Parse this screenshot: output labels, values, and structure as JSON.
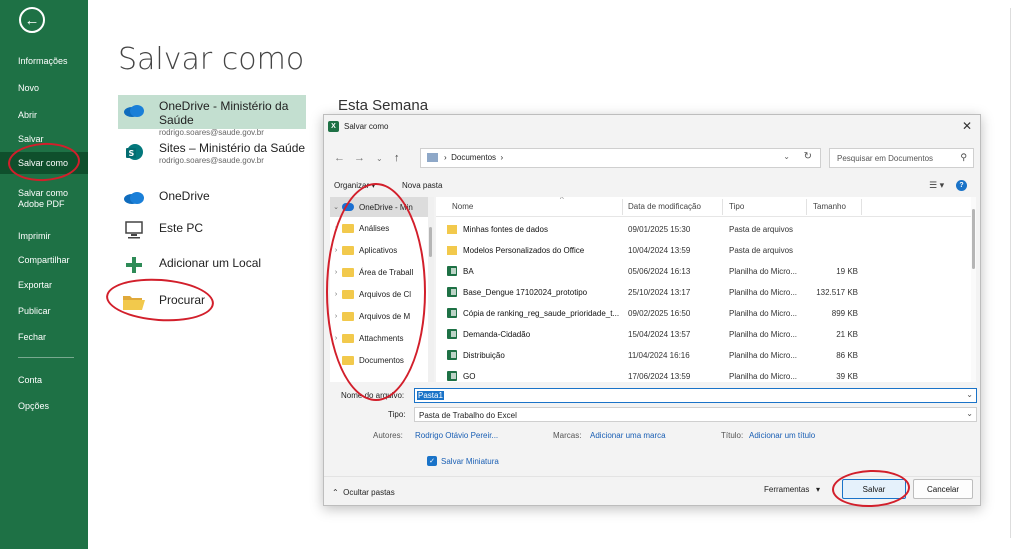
{
  "sidebar": {
    "items": [
      {
        "label": "Informações"
      },
      {
        "label": "Novo"
      },
      {
        "label": "Abrir"
      },
      {
        "label": "Salvar"
      },
      {
        "label": "Salvar como"
      },
      {
        "label": "Salvar como Adobe PDF"
      },
      {
        "label": "Imprimir"
      },
      {
        "label": "Compartilhar"
      },
      {
        "label": "Exportar"
      },
      {
        "label": "Publicar"
      },
      {
        "label": "Fechar"
      },
      {
        "label": "Conta"
      },
      {
        "label": "Opções"
      }
    ],
    "accent": "#1e7145"
  },
  "main": {
    "title": "Salvar como",
    "locations": [
      {
        "name": "OneDrive - Ministério da Saúde",
        "sub": "rodrigo.soares@saude.gov.br",
        "icon": "onedrive-icon"
      },
      {
        "name": "Sites – Ministério da Saúde",
        "sub": "rodrigo.soares@saude.gov.br",
        "icon": "sharepoint-icon"
      },
      {
        "name": "OneDrive",
        "sub": "",
        "icon": "onedrive-icon"
      },
      {
        "name": "Este PC",
        "sub": "",
        "icon": "pc-icon"
      },
      {
        "name": "Adicionar um Local",
        "sub": "",
        "icon": "plus-icon"
      },
      {
        "name": "Procurar",
        "sub": "",
        "icon": "folder-open-icon"
      }
    ],
    "section_label": "Esta Semana"
  },
  "dialog": {
    "title": "Salvar como",
    "address": "Documentos",
    "search_placeholder": "Pesquisar em Documentos",
    "organize": "Organizar",
    "new_folder": "Nova pasta",
    "tree": [
      {
        "label": "OneDrive - Min"
      },
      {
        "label": "Análises"
      },
      {
        "label": "Aplicativos"
      },
      {
        "label": "Área de Traball"
      },
      {
        "label": "Arquivos de Cl"
      },
      {
        "label": "Arquivos de M"
      },
      {
        "label": "Attachments"
      },
      {
        "label": "Documentos"
      }
    ],
    "columns": {
      "name": "Nome",
      "date": "Data de modificação",
      "type": "Tipo",
      "size": "Tamanho"
    },
    "files": [
      {
        "name": "Minhas fontes de dados",
        "date": "09/01/2025 15:30",
        "type": "Pasta de arquivos",
        "size": "",
        "icon": "folder-icon"
      },
      {
        "name": "Modelos Personalizados do Office",
        "date": "10/04/2024 13:59",
        "type": "Pasta de arquivos",
        "size": "",
        "icon": "folder-icon"
      },
      {
        "name": "BA",
        "date": "05/06/2024 16:13",
        "type": "Planilha do Micro...",
        "size": "19 KB",
        "icon": "excel-icon"
      },
      {
        "name": "Base_Dengue 17102024_prototipo",
        "date": "25/10/2024 13:17",
        "type": "Planilha do Micro...",
        "size": "132.517 KB",
        "icon": "excel-icon"
      },
      {
        "name": "Cópia de ranking_reg_saude_prioridade_t...",
        "date": "09/02/2025 16:50",
        "type": "Planilha do Micro...",
        "size": "899 KB",
        "icon": "excel-icon"
      },
      {
        "name": "Demanda-Cidadão",
        "date": "15/04/2024 13:57",
        "type": "Planilha do Micro...",
        "size": "21 KB",
        "icon": "excel-icon"
      },
      {
        "name": "Distribuição",
        "date": "11/04/2024 16:16",
        "type": "Planilha do Micro...",
        "size": "86 KB",
        "icon": "excel-icon"
      },
      {
        "name": "GO",
        "date": "17/06/2024 13:59",
        "type": "Planilha do Micro...",
        "size": "39 KB",
        "icon": "excel-icon"
      }
    ],
    "filename_label": "Nome do arquivo:",
    "filename_value": "Pasta1",
    "type_label": "Tipo:",
    "type_value": "Pasta de Trabalho do Excel",
    "authors_label": "Autores:",
    "authors_value": "Rodrigo Otávio Pereir...",
    "tags_label": "Marcas:",
    "tags_value": "Adicionar uma marca",
    "title_label": "Título:",
    "title_value": "Adicionar um título",
    "save_thumbnail": "Salvar Miniatura",
    "hide_folders": "Ocultar pastas",
    "tools": "Ferramentas",
    "save": "Salvar",
    "cancel": "Cancelar"
  },
  "annotation_color": "#d21f2b"
}
